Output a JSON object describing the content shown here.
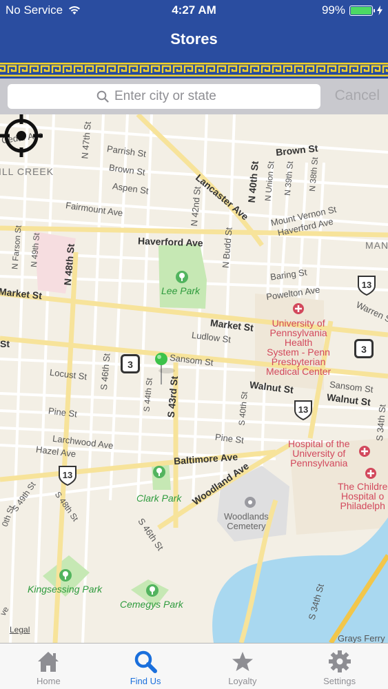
{
  "status": {
    "carrier": "No Service",
    "time": "4:27 AM",
    "battery": "99%",
    "battery_level": 0.99
  },
  "nav": {
    "title": "Stores"
  },
  "search": {
    "placeholder": "Enter city or state",
    "cancel_label": "Cancel"
  },
  "map": {
    "legal_label": "Legal",
    "areas": [
      "ILL CREEK",
      "MAN"
    ],
    "streets": [
      "Cedar Ave",
      "N 47th St",
      "Parrish St",
      "Brown St",
      "Aspen St",
      "Fairmount Ave",
      "Brown St",
      "Lancaster Ave",
      "N 40th St",
      "N Union St",
      "N 39th St",
      "N 38th St",
      "N 42nd St",
      "Mount Vernon St",
      "Haverford Ave",
      "N Farson St",
      "N 49th St",
      "N 48th St",
      "Haverford Ave",
      "N Budd St",
      "Baring St",
      "Market St",
      "Powelton Ave",
      "Warren St",
      "Market St",
      "Ludlow St",
      "St",
      "Sansom St",
      "Locust St",
      "S 46th St",
      "Walnut St",
      "Sansom St",
      "Walnut St",
      "S 44th St",
      "S 43rd St",
      "Pine St",
      "S 40th St",
      "Larchwood Ave",
      "Pine St",
      "Hazel Ave",
      "Baltimore Ave",
      "Woodland Ave",
      "S 49th St",
      "S 48th St",
      "0th St",
      "S 46th St",
      "S 34th St",
      "S 34th St",
      "Grays Ferry",
      "ve"
    ],
    "parks": [
      "Lee Park",
      "Clark Park",
      "Kingsessing Park",
      "Cemegys Park"
    ],
    "hospitals": [
      "University of\nPennsylvania\nHealth\nSystem - Penn\nPresbyterian\nMedical Center",
      "Hospital of the\nUniversity of\nPennsylvania",
      "The Childre\nHospital o\nPhiladelph"
    ],
    "cemetery": "Woodlands\nCemetery",
    "route_shields": [
      "3",
      "3",
      "13",
      "13",
      "13"
    ]
  },
  "tabs": [
    {
      "label": "Home",
      "icon": "home-icon",
      "active": false
    },
    {
      "label": "Find Us",
      "icon": "search-icon",
      "active": true
    },
    {
      "label": "Loyalty",
      "icon": "star-icon",
      "active": false
    },
    {
      "label": "Settings",
      "icon": "gear-icon",
      "active": false
    }
  ],
  "colors": {
    "nav_bg": "#2a4da0",
    "greek_key": "#f2d22a",
    "active_tab": "#1a6fdc",
    "park": "#c6e8b4",
    "hospital": "#d2485c",
    "pin": "#3cc24a"
  }
}
